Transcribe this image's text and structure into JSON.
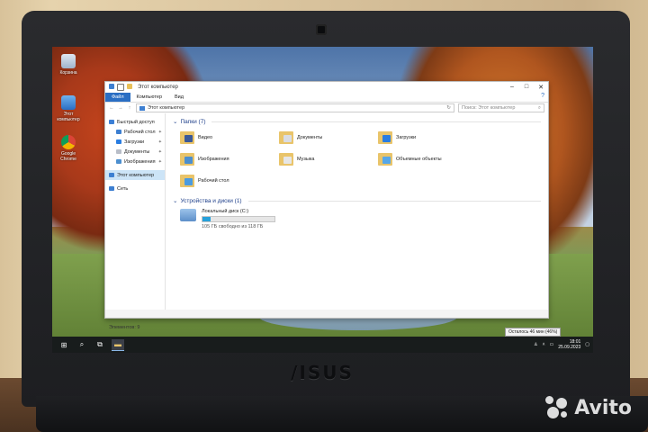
{
  "desktop": {
    "icons": [
      {
        "label": "Корзина"
      },
      {
        "label": "Этот компьютер"
      },
      {
        "label": "Google Chrome"
      }
    ]
  },
  "explorer": {
    "title": "Этот компьютер",
    "ribbon_tabs": [
      "Файл",
      "Компьютер",
      "Вид"
    ],
    "address": {
      "path": "Этот компьютер",
      "search_placeholder": "Поиск: Этот компьютер"
    },
    "nav": [
      {
        "label": "Быстрый доступ"
      },
      {
        "label": "Рабочий стол",
        "pinned": true
      },
      {
        "label": "Загрузки",
        "pinned": true
      },
      {
        "label": "Документы",
        "pinned": true
      },
      {
        "label": "Изображения",
        "pinned": true
      },
      {
        "label": "Этот компьютер",
        "selected": true
      },
      {
        "label": "Сеть"
      }
    ],
    "folders_header": "Папки (7)",
    "folders": [
      {
        "label": "Видео",
        "color": "#3b5998"
      },
      {
        "label": "Документы",
        "color": "#d9dce3"
      },
      {
        "label": "Загрузки",
        "color": "#2a7de1"
      },
      {
        "label": "Изображения",
        "color": "#4c8fcf"
      },
      {
        "label": "Музыка",
        "color": "#e6e6e6"
      },
      {
        "label": "Объемные объекты",
        "color": "#57a7e8"
      },
      {
        "label": "Рабочий стол",
        "color": "#4b9be0"
      }
    ],
    "devices_header": "Устройства и диски (1)",
    "drive": {
      "name": "Локальный диск (C:)",
      "free_text": "105 ГБ свободно из 118 ГБ",
      "used_fraction": 0.11
    },
    "status": "Элементов: 9"
  },
  "taskbar": {
    "tooltip": "Осталось 46 мин (46%)",
    "clock_time": "18:01",
    "clock_date": "25.09.2023"
  },
  "laptop": {
    "brand": "/ISUS"
  },
  "watermark": {
    "text": "Avito"
  }
}
